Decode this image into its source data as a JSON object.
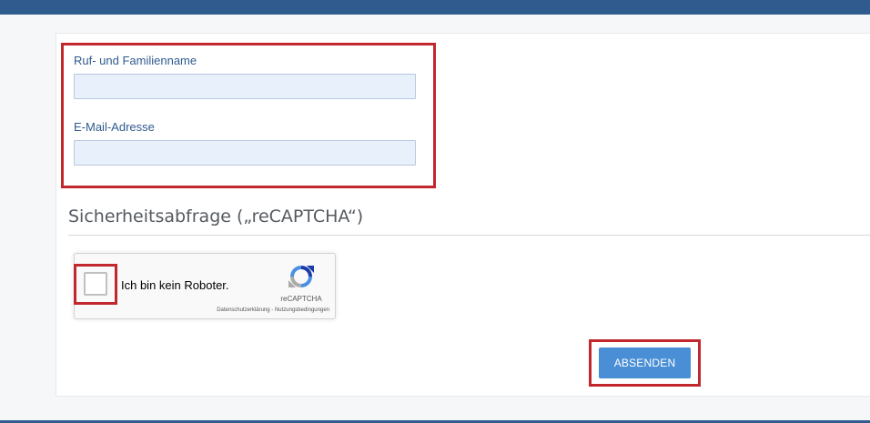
{
  "form": {
    "name_label": "Ruf- und Familienname",
    "name_value": "",
    "email_label": "E-Mail-Adresse",
    "email_value": ""
  },
  "captcha": {
    "section_title": "Sicherheitsabfrage („reCAPTCHA“)",
    "checkbox_label": "Ich bin kein Roboter.",
    "brand": "reCAPTCHA",
    "privacy_link": "Datenschutzerklärung",
    "separator": " - ",
    "terms_link": "Nutzungsbedingungen",
    "checked": false
  },
  "actions": {
    "submit_label": "ABSENDEN"
  },
  "icons": {
    "captcha_logo": "recaptcha-logo-icon"
  },
  "colors": {
    "header_bar": "#2f5b8e",
    "label_blue": "#2f5b8e",
    "input_bg": "#e8f0fb",
    "button_bg": "#4a8fd6",
    "highlight_red": "#c1272d"
  }
}
